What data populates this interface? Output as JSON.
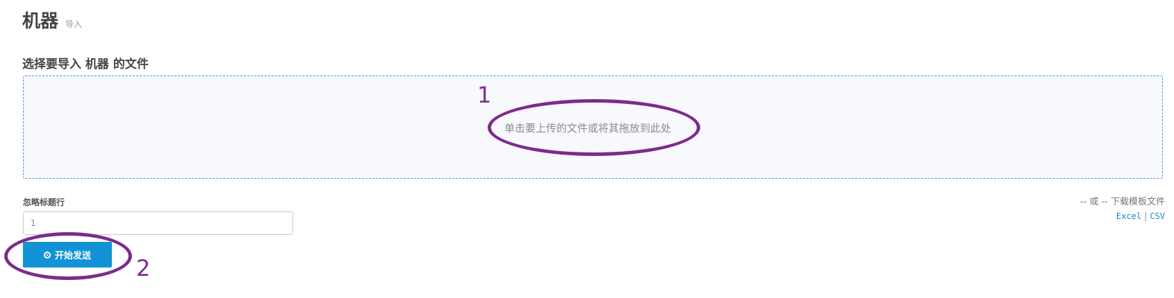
{
  "header": {
    "title": "机器",
    "subtitle": "导入"
  },
  "section": {
    "heading": "选择要导入 机器 的文件"
  },
  "dropzone": {
    "text": "单击要上传的文件或将其拖放到此处"
  },
  "ignore_header": {
    "label": "忽略标题行",
    "value": "1"
  },
  "start_button": {
    "label": "开始发送",
    "icon": "circle-play-icon"
  },
  "templates": {
    "intro": "-- 或 -- 下载模板文件",
    "excel": "Excel",
    "separator": "|",
    "csv": "CSV"
  },
  "annotations": {
    "one": "1",
    "two": "2",
    "color": "#7e2a8d"
  },
  "colors": {
    "accent": "#1293d6",
    "link": "#1b86c7",
    "dropzone_border": "#4a90d9"
  }
}
